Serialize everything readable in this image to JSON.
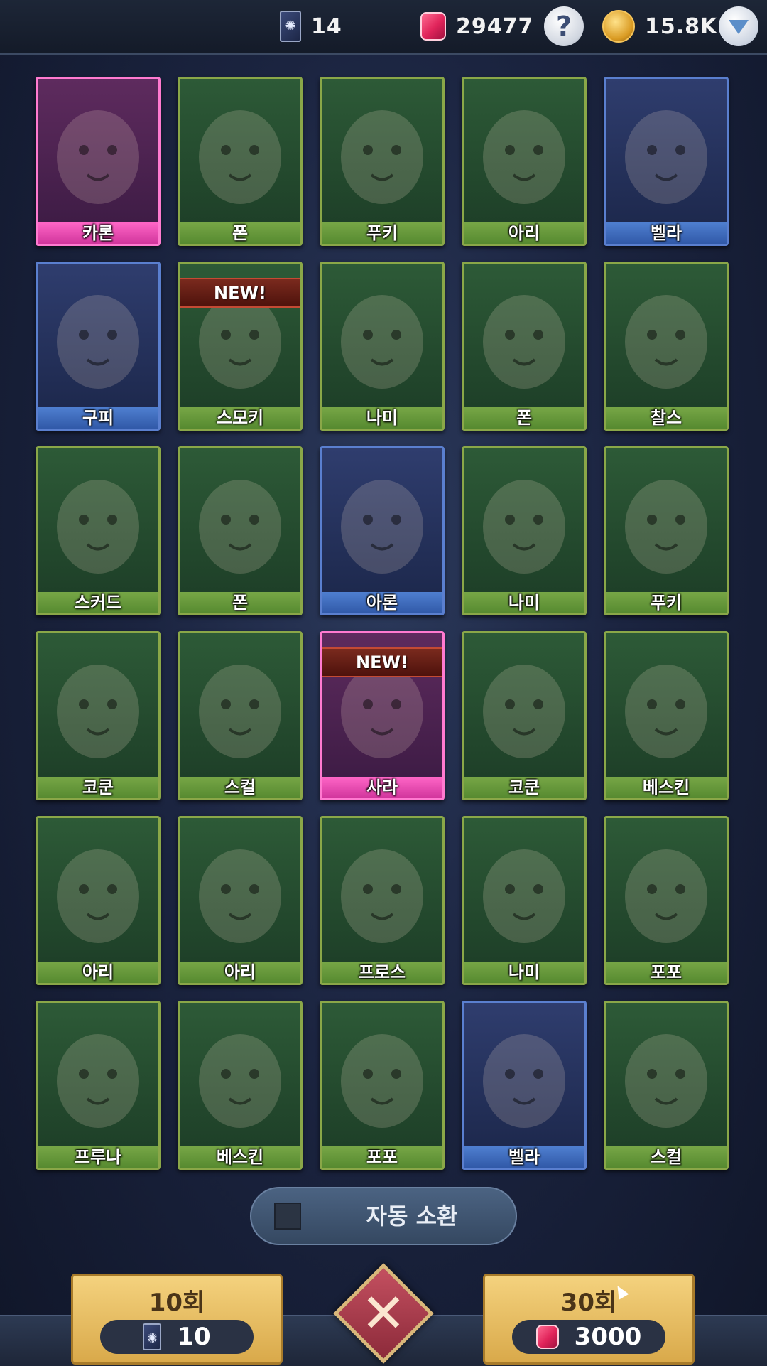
{
  "topbar": {
    "tickets": "14",
    "gems": "29477",
    "help_symbol": "?",
    "gold": "15.8K"
  },
  "cards": [
    {
      "name": "카론",
      "rarity": "pink",
      "new": false
    },
    {
      "name": "폰",
      "rarity": "green",
      "new": false
    },
    {
      "name": "푸키",
      "rarity": "green",
      "new": false
    },
    {
      "name": "아리",
      "rarity": "green",
      "new": false
    },
    {
      "name": "벨라",
      "rarity": "blue",
      "new": false
    },
    {
      "name": "구피",
      "rarity": "blue",
      "new": false
    },
    {
      "name": "스모키",
      "rarity": "green",
      "new": true
    },
    {
      "name": "나미",
      "rarity": "green",
      "new": false
    },
    {
      "name": "폰",
      "rarity": "green",
      "new": false
    },
    {
      "name": "찰스",
      "rarity": "green",
      "new": false
    },
    {
      "name": "스커드",
      "rarity": "green",
      "new": false
    },
    {
      "name": "폰",
      "rarity": "green",
      "new": false
    },
    {
      "name": "아론",
      "rarity": "blue",
      "new": false
    },
    {
      "name": "나미",
      "rarity": "green",
      "new": false
    },
    {
      "name": "푸키",
      "rarity": "green",
      "new": false
    },
    {
      "name": "코쿤",
      "rarity": "green",
      "new": false
    },
    {
      "name": "스컬",
      "rarity": "green",
      "new": false
    },
    {
      "name": "사라",
      "rarity": "pink",
      "new": true
    },
    {
      "name": "코쿤",
      "rarity": "green",
      "new": false
    },
    {
      "name": "베스킨",
      "rarity": "green",
      "new": false
    },
    {
      "name": "아리",
      "rarity": "green",
      "new": false
    },
    {
      "name": "아리",
      "rarity": "green",
      "new": false
    },
    {
      "name": "프로스",
      "rarity": "green",
      "new": false
    },
    {
      "name": "나미",
      "rarity": "green",
      "new": false
    },
    {
      "name": "포포",
      "rarity": "green",
      "new": false
    },
    {
      "name": "프루나",
      "rarity": "green",
      "new": false
    },
    {
      "name": "베스킨",
      "rarity": "green",
      "new": false
    },
    {
      "name": "포포",
      "rarity": "green",
      "new": false
    },
    {
      "name": "벨라",
      "rarity": "blue",
      "new": false
    },
    {
      "name": "스컬",
      "rarity": "green",
      "new": false
    }
  ],
  "new_badge_text": "NEW!",
  "auto_summon": {
    "label": "자동 소환",
    "checked": false
  },
  "summon_10": {
    "title": "10회",
    "cost": "10",
    "currency_icon": "ticket-icon"
  },
  "summon_30": {
    "title": "30회",
    "cost": "3000",
    "currency_icon": "gem-icon"
  },
  "close_symbol": "✕"
}
